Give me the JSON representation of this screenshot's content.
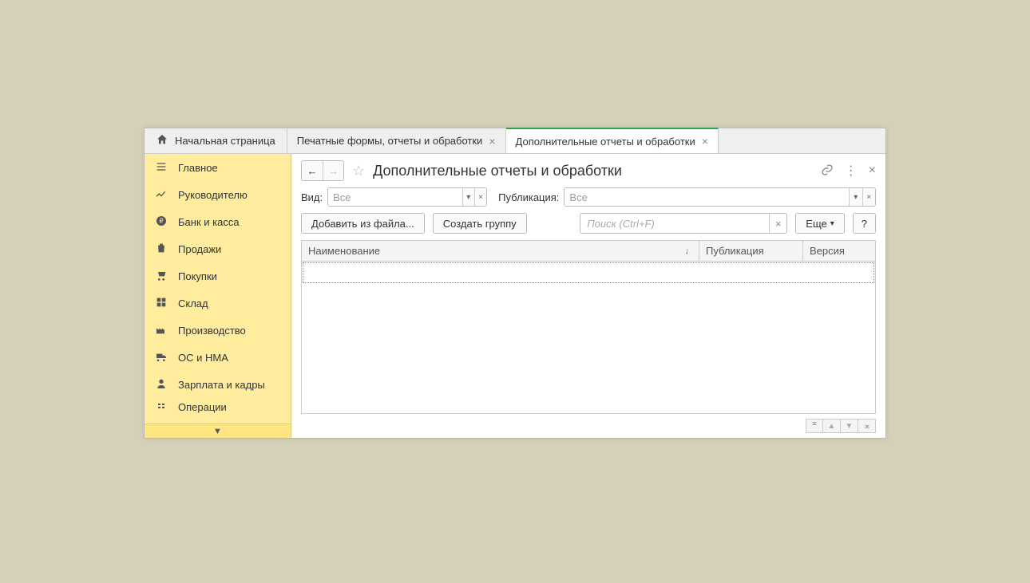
{
  "tabs": {
    "home": "Начальная страница",
    "items": [
      {
        "label": "Печатные формы, отчеты и обработки",
        "active": false
      },
      {
        "label": "Дополнительные отчеты и обработки",
        "active": true
      }
    ]
  },
  "sidebar": {
    "items": [
      {
        "label": "Главное"
      },
      {
        "label": "Руководителю"
      },
      {
        "label": "Банк и касса"
      },
      {
        "label": "Продажи"
      },
      {
        "label": "Покупки"
      },
      {
        "label": "Склад"
      },
      {
        "label": "Производство"
      },
      {
        "label": "ОС и НМА"
      },
      {
        "label": "Зарплата и кадры"
      },
      {
        "label": "Операции"
      }
    ]
  },
  "page": {
    "title": "Дополнительные отчеты и обработки"
  },
  "filters": {
    "kind_label": "Вид:",
    "kind_value": "Все",
    "pub_label": "Публикация:",
    "pub_value": "Все"
  },
  "toolbar": {
    "add_from_file": "Добавить из файла...",
    "create_group": "Создать группу",
    "search_placeholder": "Поиск (Ctrl+F)",
    "more": "Еще",
    "help": "?"
  },
  "grid": {
    "columns": {
      "name": "Наименование",
      "publication": "Публикация",
      "version": "Версия"
    }
  }
}
